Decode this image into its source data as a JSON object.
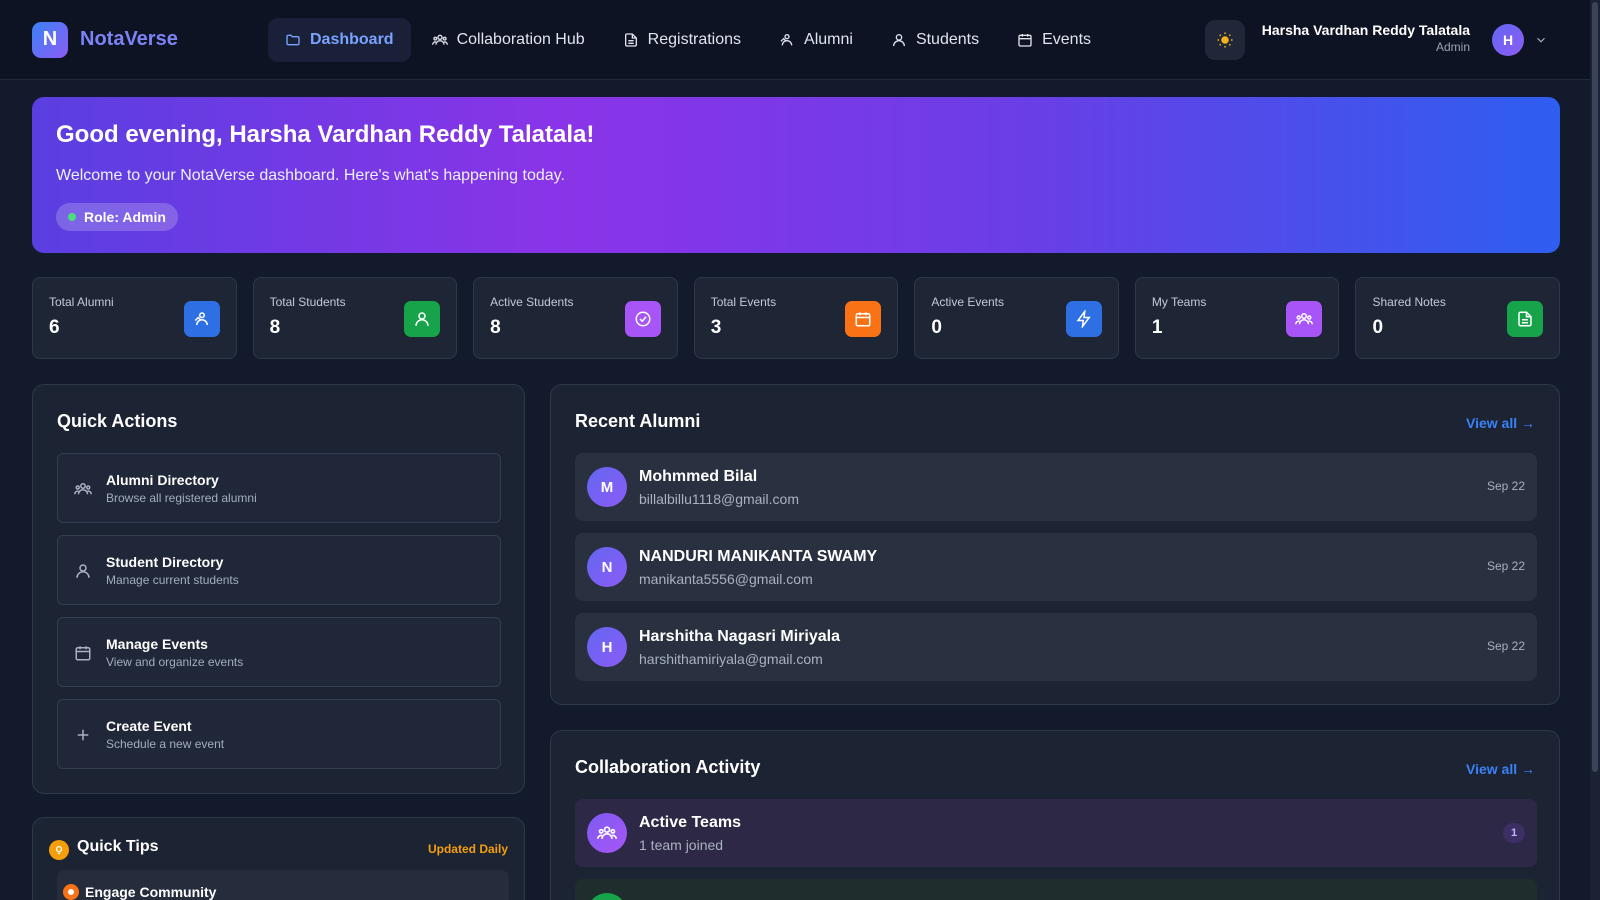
{
  "app": {
    "logo_letter": "N",
    "name": "NotaVerse"
  },
  "nav": [
    {
      "label": "Dashboard",
      "icon": "folder-icon",
      "active": true
    },
    {
      "label": "Collaboration Hub",
      "icon": "users-group-icon",
      "active": false
    },
    {
      "label": "Registrations",
      "icon": "document-icon",
      "active": false
    },
    {
      "label": "Alumni",
      "icon": "alumni-icon",
      "active": false
    },
    {
      "label": "Students",
      "icon": "user-icon",
      "active": false
    },
    {
      "label": "Events",
      "icon": "calendar-icon",
      "active": false
    }
  ],
  "user": {
    "name": "Harsha Vardhan Reddy Talatala",
    "role": "Admin",
    "initial": "H"
  },
  "hero": {
    "greeting": "Good evening, Harsha Vardhan Reddy Talatala!",
    "subtitle": "Welcome to your NotaVerse dashboard. Here's what's happening today.",
    "role_pill": "Role: Admin"
  },
  "stats": [
    {
      "label": "Total Alumni",
      "value": "6",
      "color": "#2f6fe4",
      "icon": "alumni-icon"
    },
    {
      "label": "Total Students",
      "value": "8",
      "color": "#16a34a",
      "icon": "user-icon"
    },
    {
      "label": "Active Students",
      "value": "8",
      "color": "#a855f7",
      "icon": "check-circle-icon"
    },
    {
      "label": "Total Events",
      "value": "3",
      "color": "#f97316",
      "icon": "calendar-icon"
    },
    {
      "label": "Active Events",
      "value": "0",
      "color": "#2f6fe4",
      "icon": "lightning-icon"
    },
    {
      "label": "My Teams",
      "value": "1",
      "color": "#a855f7",
      "icon": "users-group-icon"
    },
    {
      "label": "Shared Notes",
      "value": "0",
      "color": "#16a34a",
      "icon": "document-icon"
    }
  ],
  "quick_actions": {
    "title": "Quick Actions",
    "items": [
      {
        "title": "Alumni Directory",
        "subtitle": "Browse all registered alumni",
        "icon": "users-group-icon"
      },
      {
        "title": "Student Directory",
        "subtitle": "Manage current students",
        "icon": "user-icon"
      },
      {
        "title": "Manage Events",
        "subtitle": "View and organize events",
        "icon": "calendar-icon"
      },
      {
        "title": "Create Event",
        "subtitle": "Schedule a new event",
        "icon": "plus-icon"
      }
    ]
  },
  "recent_alumni": {
    "title": "Recent Alumni",
    "view_all": "View all →",
    "items": [
      {
        "initial": "M",
        "name": "Mohmmed Bilal",
        "email": "billalbillu1118@gmail.com",
        "date": "Sep 22"
      },
      {
        "initial": "N",
        "name": "NANDURI MANIKANTA SWAMY",
        "email": "manikanta5556@gmail.com",
        "date": "Sep 22"
      },
      {
        "initial": "H",
        "name": "Harshitha Nagasri Miriyala",
        "email": "harshithamiriyala@gmail.com",
        "date": "Sep 22"
      }
    ]
  },
  "collaboration": {
    "title": "Collaboration Activity",
    "view_all": "View all →",
    "items": [
      {
        "title": "Active Teams",
        "subtitle": "1 team joined",
        "badge": "1"
      }
    ]
  },
  "quick_tips": {
    "title": "Quick Tips",
    "updated": "Updated Daily",
    "items": [
      {
        "title": "Engage Community"
      }
    ]
  }
}
